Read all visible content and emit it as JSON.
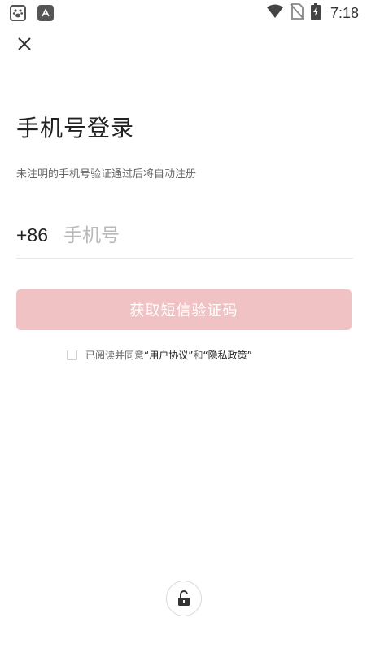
{
  "status_bar": {
    "time": "7:18",
    "left_icons": [
      "paw-app-icon",
      "text-app-icon"
    ],
    "right_icons": [
      "wifi-icon",
      "no-sim-icon",
      "battery-charging-icon"
    ]
  },
  "header": {
    "close_icon": "close-icon"
  },
  "login": {
    "title": "手机号登录",
    "subtitle": "未注明的手机号验证通过后将自动注册",
    "country_code": "+86",
    "phone_placeholder": "手机号",
    "phone_value": "",
    "get_code_label": "获取短信验证码"
  },
  "agreement": {
    "checked": false,
    "prefix": "已阅读并同意",
    "user_agreement": "“用户协议”",
    "and": " 和",
    "privacy_policy": "“隐私政策”"
  },
  "colors": {
    "button_disabled": "#f0c2c4",
    "background": "#ffffff",
    "title": "#222222"
  },
  "bottom": {
    "lock_icon": "lock-open-icon"
  }
}
